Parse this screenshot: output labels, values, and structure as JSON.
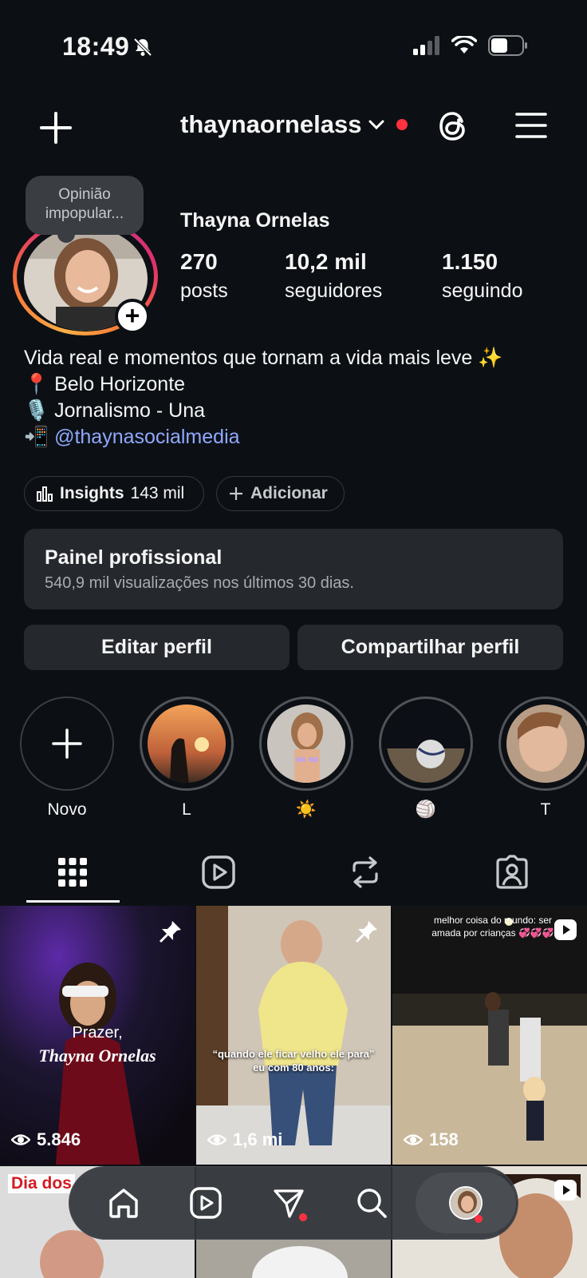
{
  "status_bar": {
    "time": "18:49"
  },
  "header": {
    "username": "thaynaornelass"
  },
  "profile": {
    "note": "Opinião impopular...",
    "display_name": "Thayna Ornelas",
    "stats": [
      {
        "value": "270",
        "label": "posts"
      },
      {
        "value": "10,2 mil",
        "label": "seguidores"
      },
      {
        "value": "1.150",
        "label": "seguindo"
      }
    ],
    "bio": [
      "Vida real e momentos que tornam a vida mais leve ✨",
      "📍 Belo Horizonte",
      "🎙️ Jornalismo - Una",
      "📲 "
    ],
    "bio_link": "@thaynasocialmedia"
  },
  "chips": {
    "insights_label": "Insights",
    "insights_value": "143 mil",
    "add_label": "Adicionar"
  },
  "panel": {
    "title": "Painel profissional",
    "subtitle": "540,9 mil visualizações nos últimos 30 dias."
  },
  "buttons": {
    "edit": "Editar perfil",
    "share": "Compartilhar perfil"
  },
  "highlights": [
    {
      "label": "Novo"
    },
    {
      "label": "L"
    },
    {
      "label": "☀️"
    },
    {
      "label": "🏐"
    },
    {
      "label": "T"
    }
  ],
  "grid": [
    {
      "views": "5.846",
      "overlay_1": "Prazer,",
      "overlay_2": "Thayna Ornelas"
    },
    {
      "views": "1,6 mi",
      "overlay_1": "“quando ele ficar velho ele para”",
      "overlay_2": "eu com 80 anos:"
    },
    {
      "views": "158",
      "overlay_1": "melhor coisa do mundo: ser",
      "overlay_2": "amada por crianças 💞💞💞"
    },
    {
      "overlay_1": "Dia dos"
    }
  ],
  "colors": {
    "background": "#0c1014",
    "accent_link": "#8fa9ff",
    "notification": "#ff3040"
  }
}
